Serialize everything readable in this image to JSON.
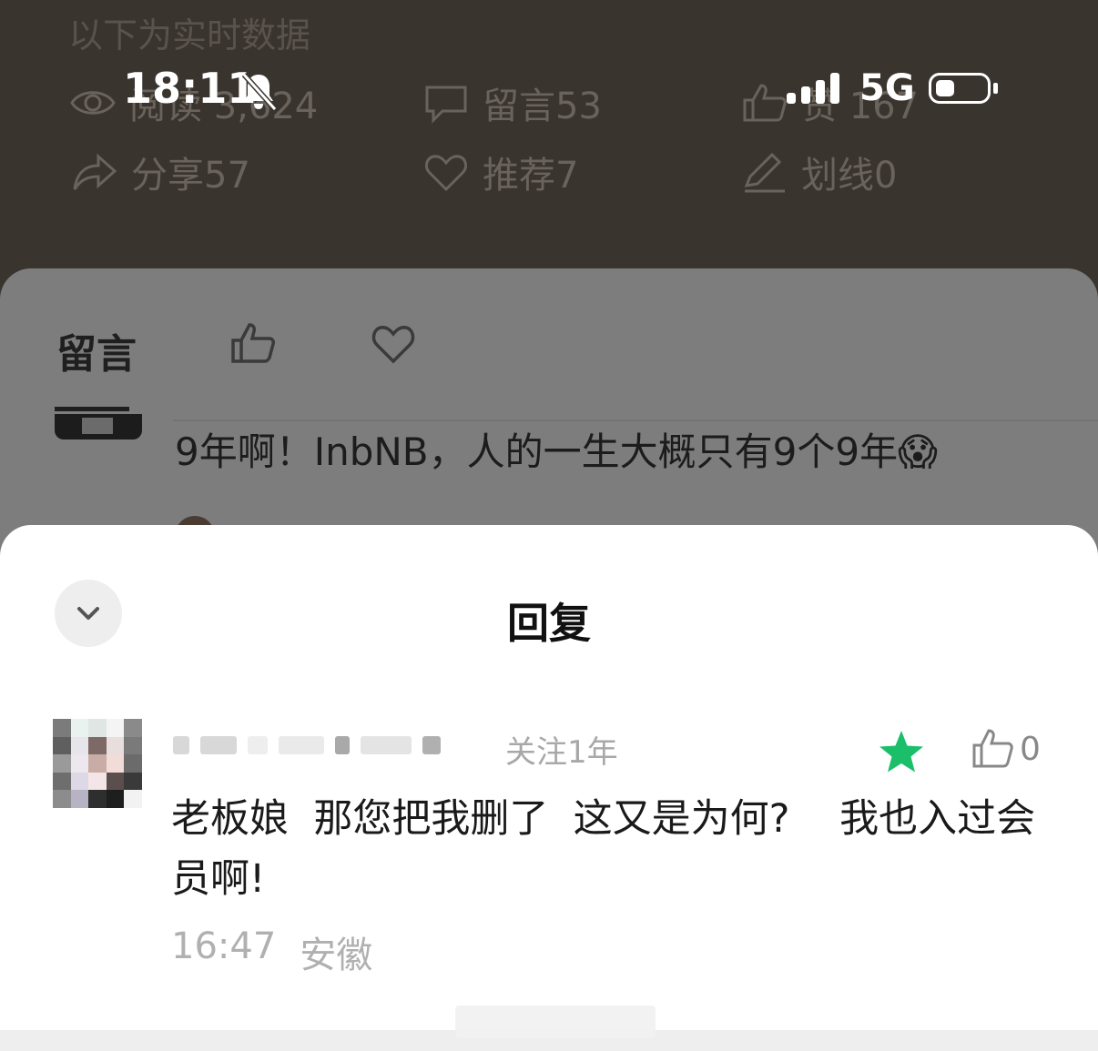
{
  "realtime_label": "以下为实时数据",
  "stats": {
    "read": "阅读 3,624",
    "comment": "留言53",
    "like": "赞 167",
    "share": "分享57",
    "recommend": "推荐7",
    "underline": "划线0"
  },
  "statusbar": {
    "time": "18:11",
    "network": "5G",
    "icons": [
      "bell-slash-icon",
      "signal-icon",
      "battery-icon"
    ]
  },
  "comment_sheet": {
    "tab_label": "留言",
    "tab_icons": [
      "thumbs-up-icon",
      "heart-icon"
    ],
    "top_comment": "9年啊！InbNB，人的一生大概只有9个9年😱"
  },
  "reply_sheet": {
    "title": "回复",
    "reply": {
      "follow_info": "关注1年",
      "text": "老板娘  那您把我删了  这又是为何?    我也入过会员啊!",
      "like_count": "0",
      "time": "16:47",
      "location": "安徽"
    }
  },
  "colors": {
    "dim_bg": "#3a342f",
    "sheet_dim": "#7d7d7d",
    "star_green": "#1bbf6a"
  }
}
